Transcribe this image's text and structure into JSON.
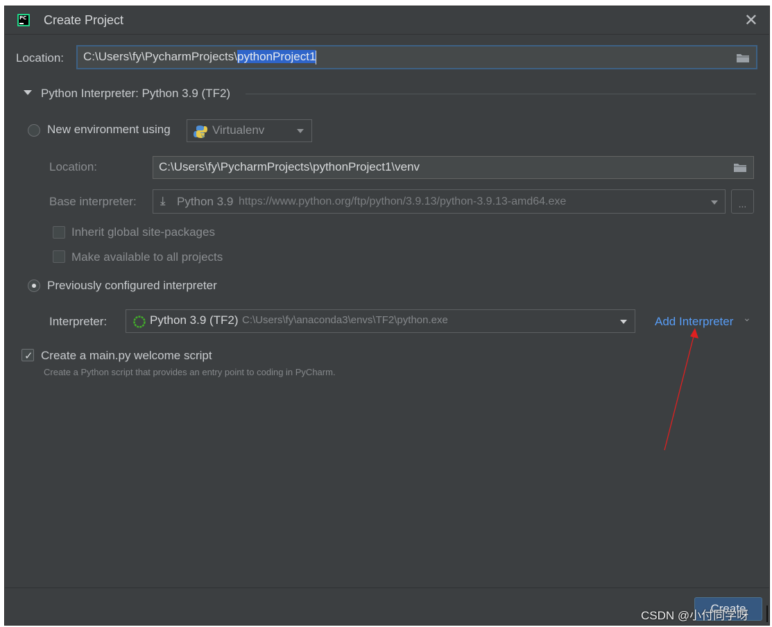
{
  "window": {
    "title": "Create Project"
  },
  "location": {
    "label": "Location:",
    "value_prefix": "C:\\Users\\fy\\PycharmProjects\\",
    "value_selected": "pythonProject1"
  },
  "interpreter_section": {
    "title": "Python Interpreter: Python 3.9 (TF2)",
    "new_env": {
      "label": "New environment using",
      "tool": "Virtualenv",
      "location_label": "Location:",
      "location_value": "C:\\Users\\fy\\PycharmProjects\\pythonProject1\\venv",
      "base_label": "Base interpreter:",
      "base_name": "Python 3.9",
      "base_url": "https://www.python.org/ftp/python/3.9.13/python-3.9.13-amd64.exe",
      "browse_label": "...",
      "inherit_label": "Inherit global site-packages",
      "available_label": "Make available to all projects"
    },
    "previous": {
      "label": "Previously configured interpreter",
      "interpreter_label": "Interpreter:",
      "interpreter_name": "Python 3.9 (TF2)",
      "interpreter_path": "C:\\Users\\fy\\anaconda3\\envs\\TF2\\python.exe",
      "add_label": "Add Interpreter"
    }
  },
  "welcome": {
    "label": "Create a main.py welcome script",
    "hint": "Create a Python script that provides an entry point to coding in PyCharm.",
    "checked": true
  },
  "footer": {
    "create_label": "Create"
  },
  "watermark": "CSDN @小付同学呀",
  "annotation_color": "#e02020"
}
